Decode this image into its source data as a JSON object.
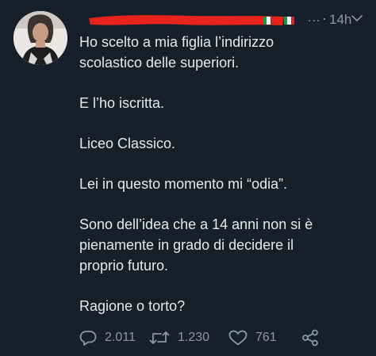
{
  "tweet": {
    "time": "14h",
    "more": "...",
    "separator": "·",
    "paragraphs": [
      {
        "lines": [
          "Ho scelto a mia figlia l’indirizzo",
          "scolastico delle superiori."
        ]
      },
      {
        "lines": [
          "E l’ho iscritta."
        ]
      },
      {
        "lines": [
          "Liceo Classico."
        ]
      },
      {
        "lines": [
          "Lei in questo momento mi “odia”."
        ]
      },
      {
        "lines": [
          "Sono dell’idea che a 14 anni non si è",
          "pienamente in grado di decidere il",
          "proprio futuro."
        ]
      },
      {
        "lines": [
          "Ragione o torto?"
        ]
      }
    ],
    "actions": {
      "replies": "2.011",
      "retweets": "1.230",
      "likes": "761"
    }
  },
  "colors": {
    "background": "#15202b",
    "text": "#e7e9ea",
    "secondary": "#8b98a5",
    "redaction": "#e8231c",
    "flag_green": "#159a48",
    "flag_white": "#ffffff",
    "flag_red": "#d6262c"
  },
  "icons": [
    "avatar-photo",
    "italy-flag",
    "chevron-down-icon",
    "reply-icon",
    "retweet-icon",
    "like-icon",
    "share-icon"
  ]
}
